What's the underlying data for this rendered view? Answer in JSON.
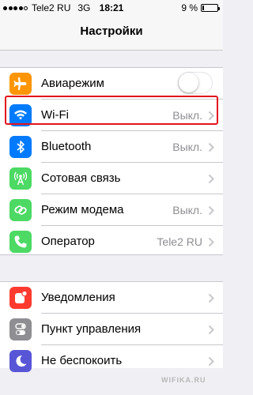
{
  "status_bar": {
    "carrier": "Tele2 RU",
    "network": "3G",
    "time": "18:21",
    "battery_label": "9 %",
    "battery_level": 0.09,
    "signal_bars": 5,
    "signal_filled": 4
  },
  "nav": {
    "title": "Настройки"
  },
  "groups": [
    {
      "rows": [
        {
          "id": "airplane",
          "label": "Авиарежим",
          "icon": "airplane-icon",
          "icon_color": "#ff9500",
          "control": "toggle",
          "toggle_on": false
        },
        {
          "id": "wifi",
          "label": "Wi-Fi",
          "value": "Выкл.",
          "icon": "wifi-icon",
          "icon_color": "#007aff"
        },
        {
          "id": "bluetooth",
          "label": "Bluetooth",
          "value": "Выкл.",
          "icon": "bluetooth-icon",
          "icon_color": "#007aff"
        },
        {
          "id": "cellular",
          "label": "Сотовая связь",
          "value": "",
          "icon": "antenna-icon",
          "icon_color": "#4cd964",
          "highlighted": true
        },
        {
          "id": "hotspot",
          "label": "Режим модема",
          "value": "Выкл.",
          "icon": "chain-icon",
          "icon_color": "#4cd964"
        },
        {
          "id": "operator",
          "label": "Оператор",
          "value": "Tele2 RU",
          "icon": "phone-icon",
          "icon_color": "#4cd964"
        }
      ]
    },
    {
      "rows": [
        {
          "id": "notifications",
          "label": "Уведомления",
          "icon": "notifications-icon",
          "icon_color": "#ff3b30"
        },
        {
          "id": "control-center",
          "label": "Пункт управления",
          "icon": "toggles-icon",
          "icon_color": "#8e8e93"
        },
        {
          "id": "dnd",
          "label": "Не беспокоить",
          "icon": "moon-icon",
          "icon_color": "#5856d6"
        }
      ]
    }
  ],
  "highlight_color": "#e3141b",
  "watermark": "WIFIKA.RU"
}
